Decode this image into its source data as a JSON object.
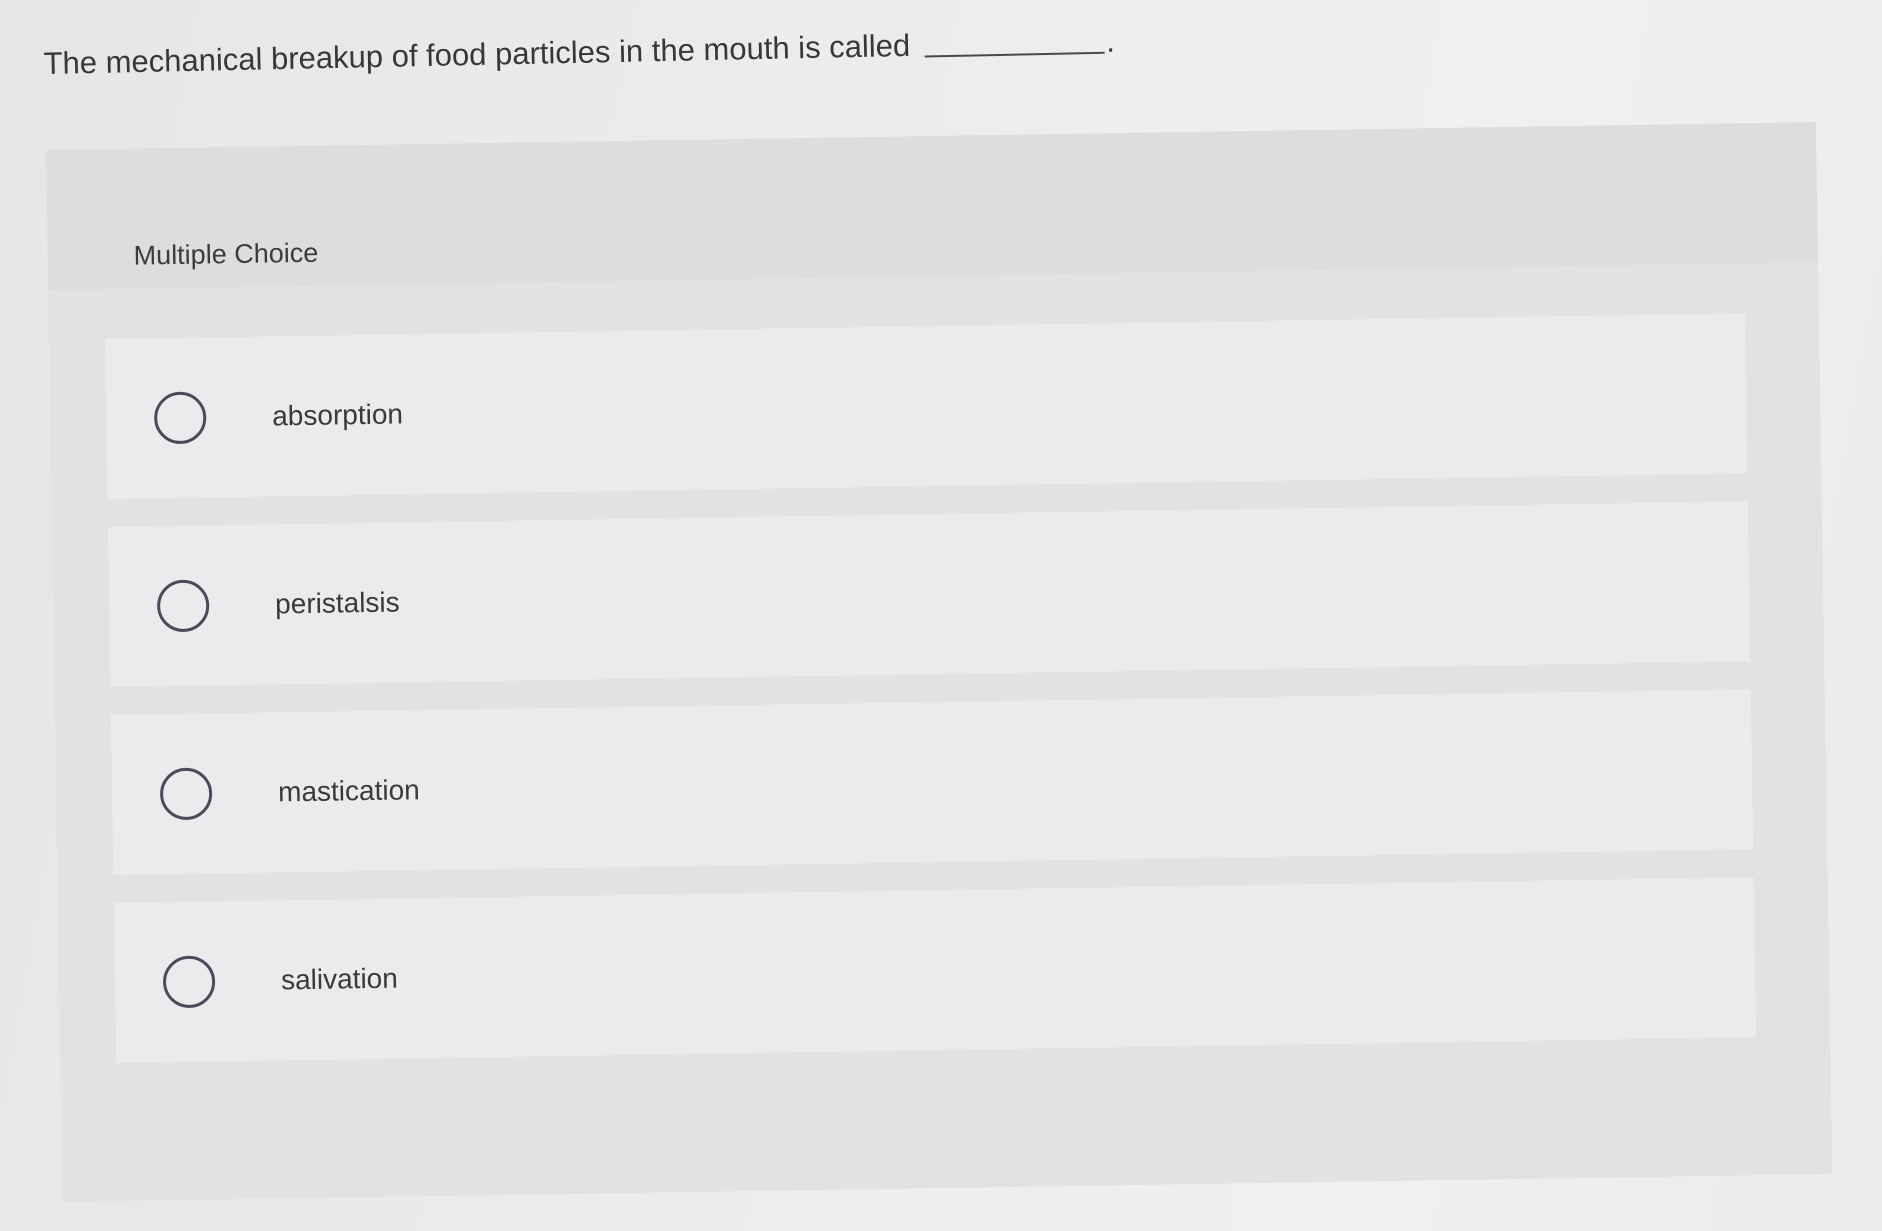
{
  "question": {
    "text": "The mechanical breakup of food particles in the mouth is called",
    "period": "."
  },
  "panel": {
    "label": "Multiple Choice"
  },
  "options": [
    {
      "label": "absorption",
      "selected": false
    },
    {
      "label": "peristalsis",
      "selected": false
    },
    {
      "label": "mastication",
      "selected": false
    },
    {
      "label": "salivation",
      "selected": false
    }
  ]
}
